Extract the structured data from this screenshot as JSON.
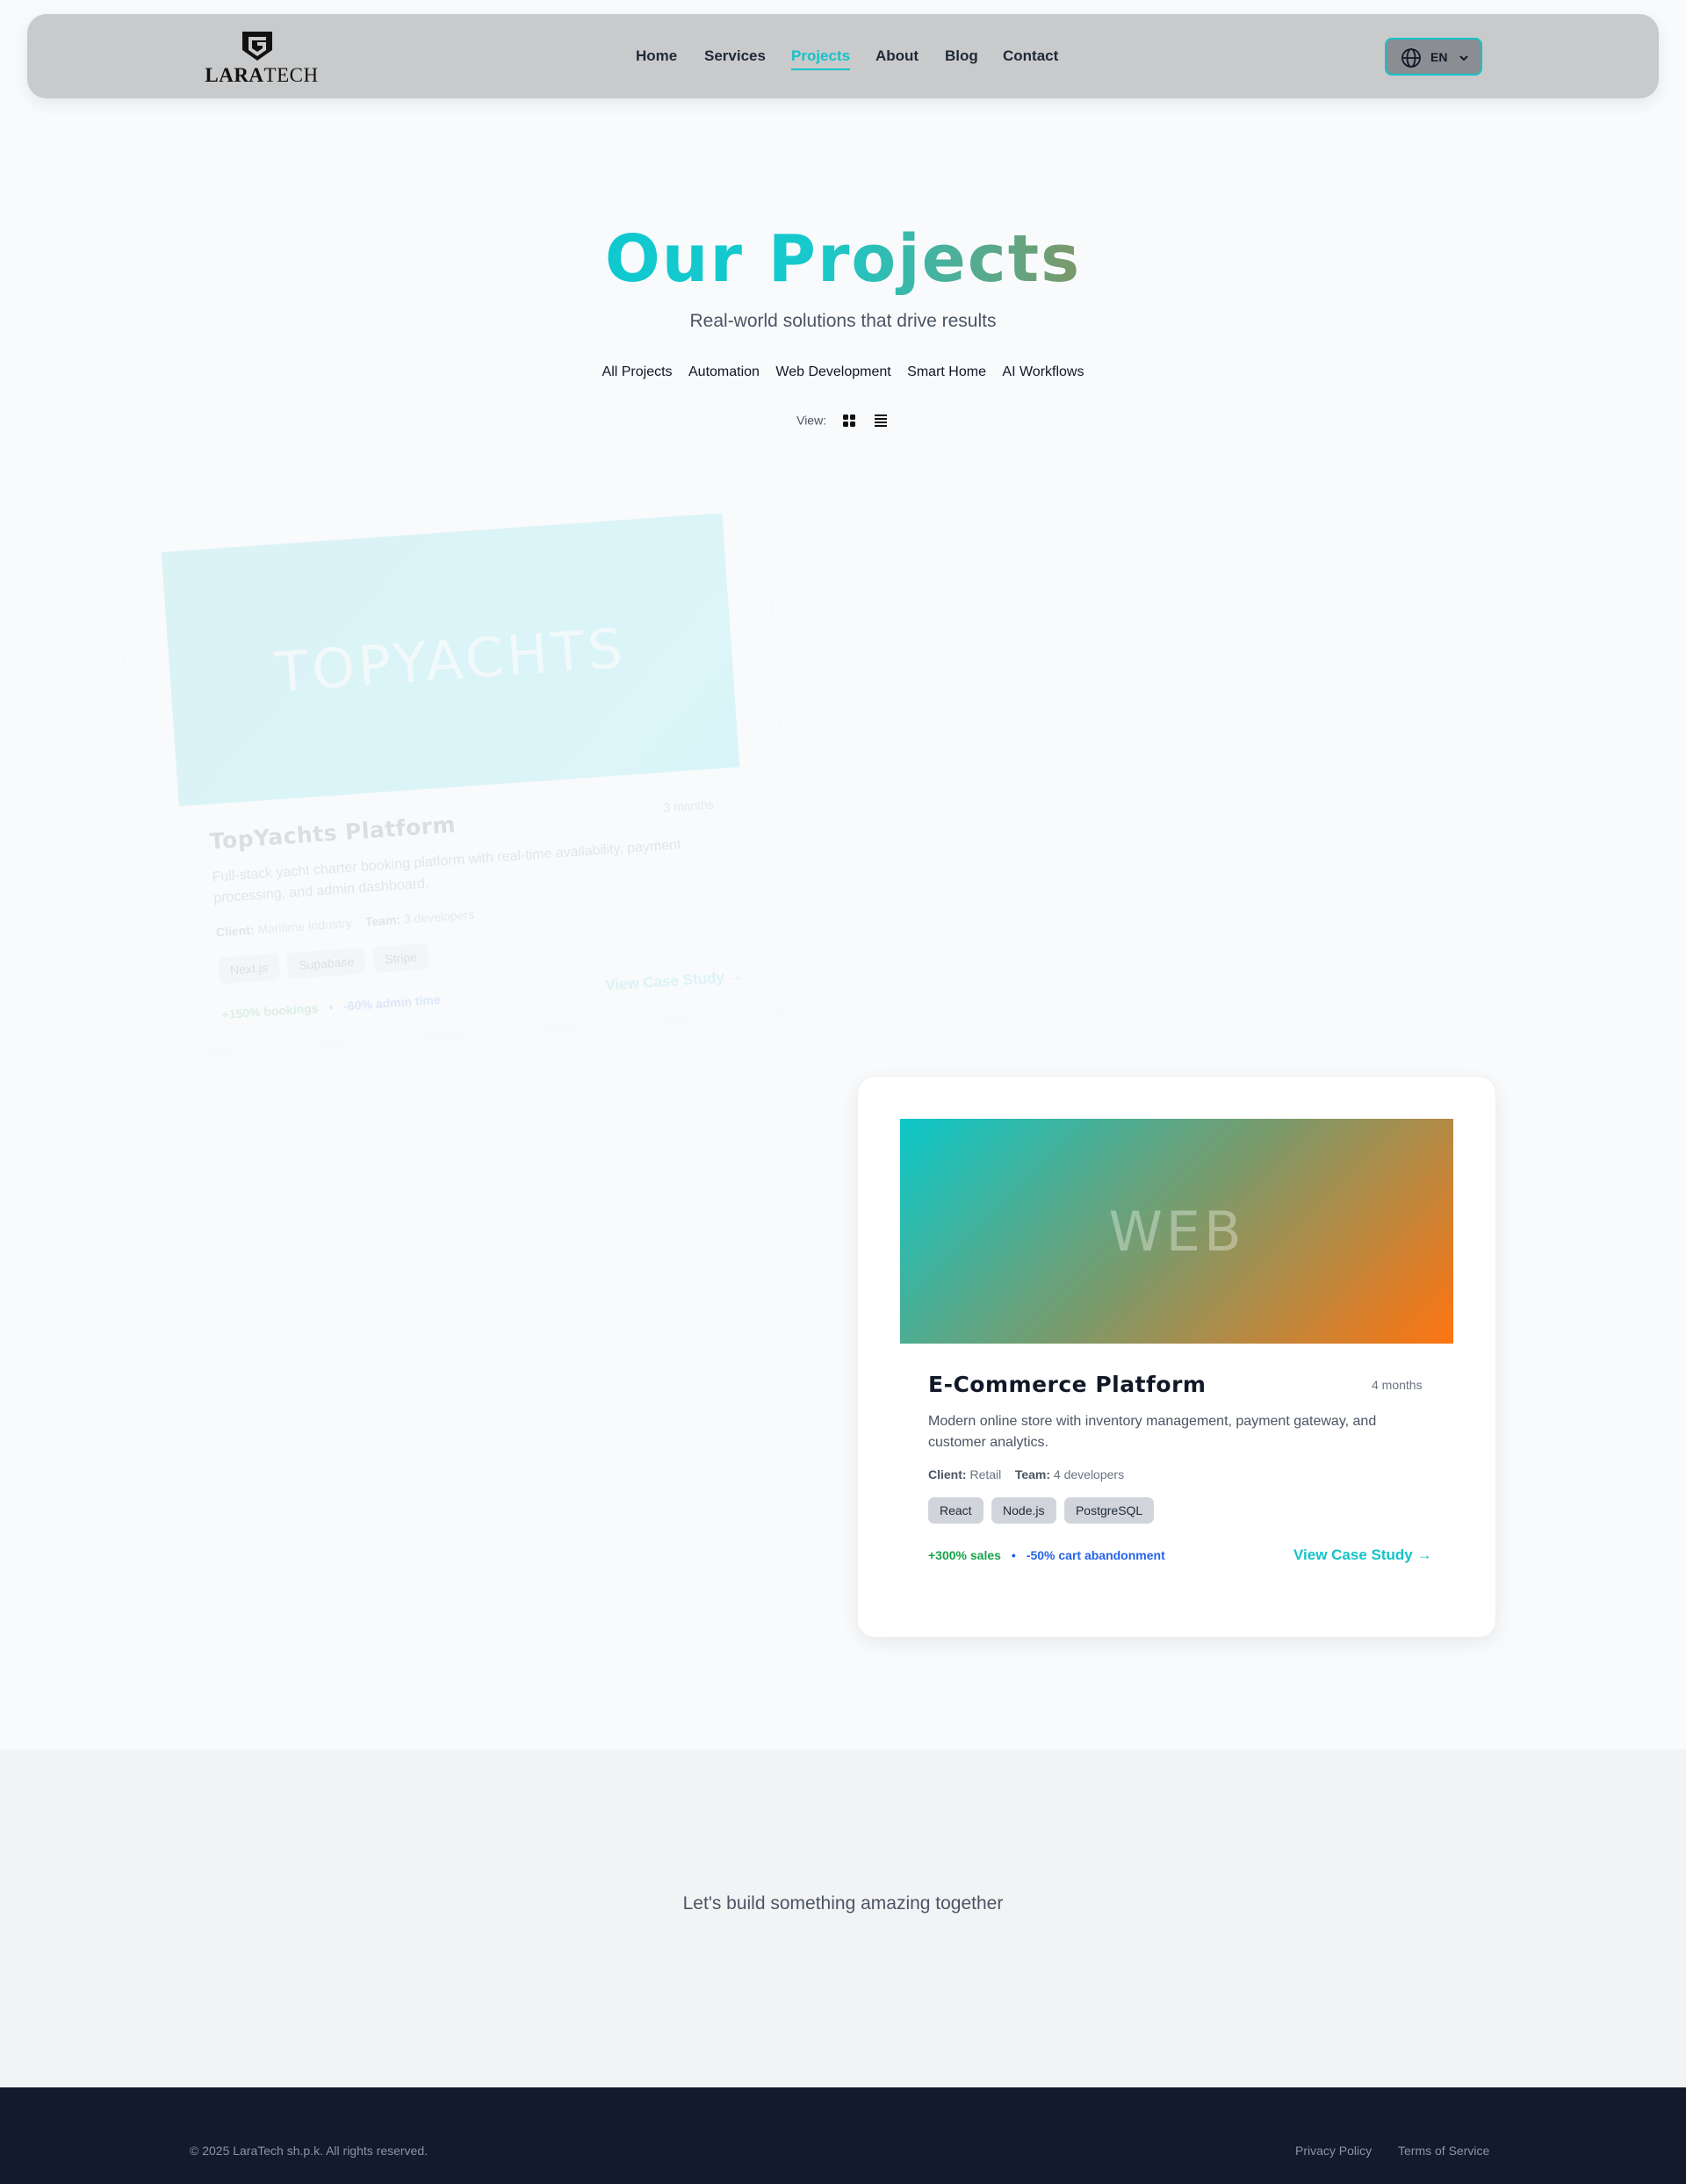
{
  "brand": {
    "name_bold": "LARA",
    "name_light": "TECH"
  },
  "nav": {
    "items": [
      {
        "label": "Home",
        "active": false
      },
      {
        "label": "Services",
        "active": false
      },
      {
        "label": "Projects",
        "active": true
      },
      {
        "label": "About",
        "active": false
      },
      {
        "label": "Blog",
        "active": false
      },
      {
        "label": "Contact",
        "active": false
      }
    ],
    "language": {
      "code": "EN",
      "icon": "globe-icon"
    }
  },
  "hero": {
    "title": "Our Projects",
    "subtitle": "Real-world solutions that drive results"
  },
  "filters": [
    "All Projects",
    "Automation",
    "Web Development",
    "Smart Home",
    "AI Workflows"
  ],
  "view": {
    "label": "View:",
    "options": [
      "grid-icon",
      "list-icon"
    ]
  },
  "projects": [
    {
      "thumb_label": "TOPYACHTS",
      "title": "TopYachts Platform",
      "duration": "3 months",
      "description": "Full-stack yacht charter booking platform with real-time availability, payment processing, and admin dashboard.",
      "client_label": "Client:",
      "client": "Maritime Industry",
      "team_label": "Team:",
      "team": "3 developers",
      "tags": [
        "Next.js",
        "Supabase",
        "Stripe"
      ],
      "metric_a": "+150% bookings",
      "metric_b": "-60% admin time",
      "cta": "View Case Study →"
    },
    {
      "thumb_label": "WEB",
      "title": "E-Commerce Platform",
      "duration": "4 months",
      "description": "Modern online store with inventory management, payment gateway, and customer analytics.",
      "client_label": "Client:",
      "client": "Retail",
      "team_label": "Team:",
      "team": "4 developers",
      "tags": [
        "React",
        "Node.js",
        "PostgreSQL"
      ],
      "metric_a": "+300% sales",
      "metric_b": "-50% cart abandonment",
      "cta": "View Case Study →"
    }
  ],
  "cta": {
    "text": "Let's build something amazing together"
  },
  "footer": {
    "copyright": "© 2025 LaraTech sh.p.k. All rights reserved.",
    "links": [
      "Privacy Policy",
      "Terms of Service"
    ]
  },
  "colors": {
    "accent": "#14c3c7",
    "footer_bg": "#131a2b",
    "nav_bg": "#c9cacb"
  }
}
